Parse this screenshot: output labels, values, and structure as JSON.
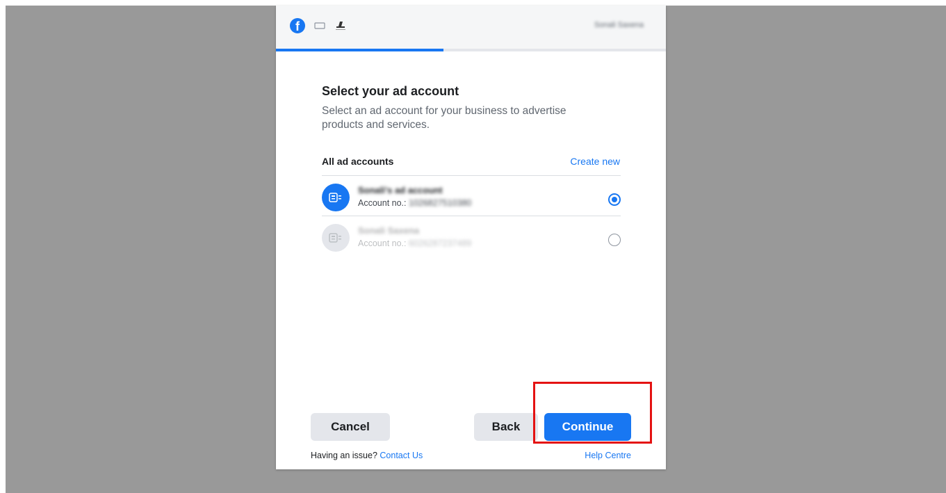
{
  "header": {
    "user_name": "Sonali Saxena",
    "progress_fraction": 0.43
  },
  "main": {
    "title": "Select your ad account",
    "subtitle": "Select an ad account for your business to advertise products and services.",
    "section_label": "All ad accounts",
    "create_new": "Create new"
  },
  "accounts": [
    {
      "name": "Sonali's ad account",
      "number_label": "Account no.:",
      "number": "1026827510380",
      "selected": true
    },
    {
      "name": "Sonali Saxena",
      "number_label": "Account no.:",
      "number": "6026287237489",
      "selected": false
    }
  ],
  "buttons": {
    "cancel": "Cancel",
    "back": "Back",
    "continue": "Continue"
  },
  "footer": {
    "issue_text": "Having an issue?",
    "contact_link": "Contact Us",
    "help_link": "Help Centre"
  },
  "colors": {
    "brand_blue": "#1877f2",
    "annotation_red": "#e41212"
  },
  "icons": [
    "facebook-logo-icon",
    "link-icon",
    "business-logo-icon",
    "ad-account-icon",
    "radio-checked-icon",
    "radio-unchecked-icon"
  ]
}
